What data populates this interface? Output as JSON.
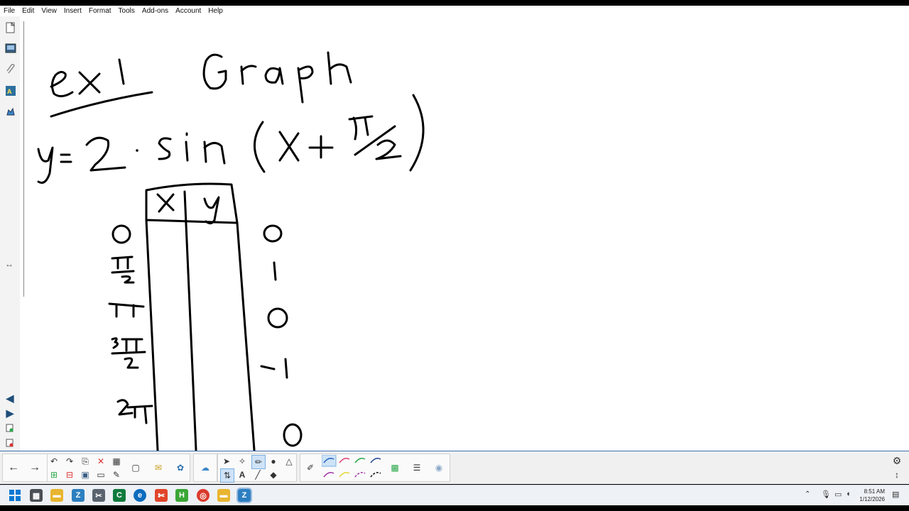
{
  "menu": {
    "items": [
      "File",
      "Edit",
      "View",
      "Insert",
      "Format",
      "Tools",
      "Add-ons",
      "Account",
      "Help"
    ]
  },
  "sidebar": {
    "icons": [
      "page-sorter-icon",
      "gallery-icon",
      "attachments-icon",
      "properties-icon",
      "addons-icon"
    ],
    "resize_glyph": "↔"
  },
  "handwriting": {
    "title": "ex 1",
    "heading": "Graph",
    "equation": "y = 2 · sin(x + π/2)",
    "table_headers": [
      "x",
      "y"
    ],
    "x_values": [
      "0",
      "π/2",
      "π",
      "3π/2",
      "2π"
    ],
    "y_values": [
      "0",
      "1",
      "0",
      "-1",
      "0"
    ]
  },
  "toolbar": {
    "nav": {
      "prev": "←",
      "next": "→"
    },
    "settings_glyph": "⚙",
    "expand_glyph": "↕"
  },
  "taskbar": {
    "time": "8:51 AM",
    "date": "1/12/2026"
  },
  "colors": {
    "accent": "#3d6fb0",
    "pen_blue": "#1f5fbf",
    "pen_red": "#e0406e",
    "pen_green": "#2aa84a",
    "pen_yellow": "#e3d62e",
    "pen_purple": "#9b2fa6"
  }
}
